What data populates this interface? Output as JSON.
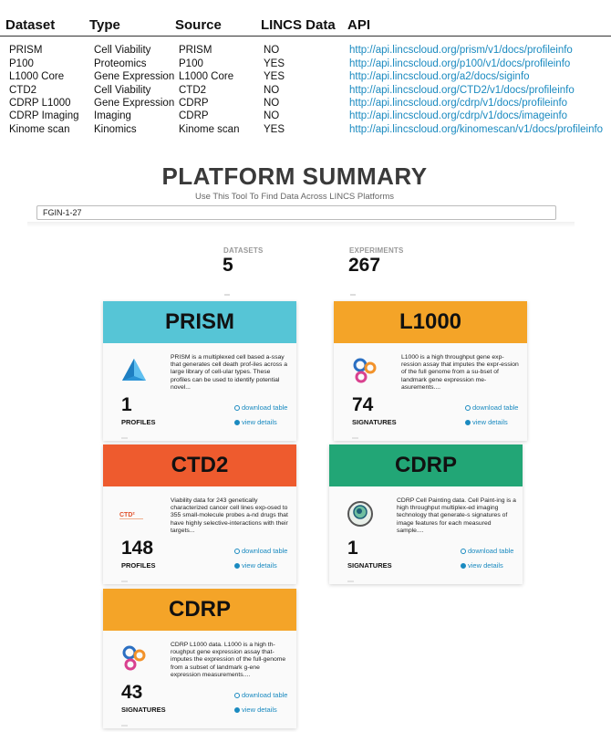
{
  "api_table": {
    "headers": [
      "Dataset",
      "Type",
      "Source",
      "LINCS Data",
      "API"
    ],
    "rows": [
      [
        "PRISM",
        "Cell Viability",
        "PRISM",
        "NO",
        "http://api.lincscloud.org/prism/v1/docs/profileinfo"
      ],
      [
        "P100",
        "Proteomics",
        "P100",
        "YES",
        "http://api.lincscloud.org/p100/v1/docs/profileinfo"
      ],
      [
        "L1000 Core",
        "Gene Expression",
        "L1000 Core",
        "YES",
        "http://api.lincscloud.org/a2/docs/siginfo"
      ],
      [
        "CTD2",
        "Cell Viability",
        "CTD2",
        "NO",
        "http://api.lincscloud.org/CTD2/v1/docs/profileinfo"
      ],
      [
        "CDRP L1000",
        "Gene Expression",
        "CDRP",
        "NO",
        "http://api.lincscloud.org/cdrp/v1/docs/profileinfo"
      ],
      [
        "CDRP Imaging",
        "Imaging",
        "CDRP",
        "NO",
        "http://api.lincscloud.org/cdrp/v1/docs/imageinfo"
      ],
      [
        "Kinome scan",
        "Kinomics",
        "Kinome scan",
        "YES",
        "http://api.lincscloud.org/kinomescan/v1/docs/profileinfo"
      ]
    ]
  },
  "summary": {
    "title": "PLATFORM SUMMARY",
    "subtitle": "Use This Tool To Find Data Across LINCS Platforms",
    "search_value": "FGIN-1-27",
    "stats": {
      "datasets_label": "DATASETS",
      "datasets_value": "5",
      "experiments_label": "EXPERIMENTS",
      "experiments_value": "267"
    }
  },
  "cards": [
    {
      "title": "PRISM",
      "color": "#56c5d6",
      "icon": "prism-pyramid-icon",
      "description": "PRISM is a multiplexed cell based a-ssay that generates cell death prof-iles across a large library of cell-ular types. These profiles can be used to identify potential novel...",
      "count": "1",
      "unit": "PROFILES",
      "download_label": "download table",
      "details_label": "view details"
    },
    {
      "title": "L1000",
      "color": "#f4a428",
      "icon": "l1000-circles-icon",
      "description": "L1000 is a high throughput gene exp-ression assay that imputes the expr-ession of the full genome from a su-bset of landmark gene expression me-asurements....",
      "count": "74",
      "unit": "SIGNATURES",
      "download_label": "download table",
      "details_label": "view details"
    },
    {
      "title": "CTD2",
      "color": "#ee5b2e",
      "icon": "ctd2-logo-icon",
      "description": "Viability data for 243 genetically characterized cancer cell lines exp-osed to 355 small-molecule probes a-nd drugs that have highly selective-interactions with their targets...",
      "count": "148",
      "unit": "PROFILES",
      "download_label": "download table",
      "details_label": "view details"
    },
    {
      "title": "CDRP",
      "color": "#22a676",
      "icon": "cell-painting-icon",
      "description": "CDRP Cell Painting data. Cell Paint-ing is a high throughput multiplex-ed imaging technology that generate-s signatures of image features for each measured sample....",
      "count": "1",
      "unit": "SIGNATURES",
      "download_label": "download table",
      "details_label": "view details"
    },
    {
      "title": "CDRP",
      "color": "#f4a428",
      "icon": "l1000-circles-icon",
      "description": "CDRP L1000 data. L1000 is a high th-roughput gene expression assay that-imputes the expression of the full-genome from a subset of landmark g-ene expression measurements....",
      "count": "43",
      "unit": "SIGNATURES",
      "download_label": "download table",
      "details_label": "view details"
    }
  ]
}
